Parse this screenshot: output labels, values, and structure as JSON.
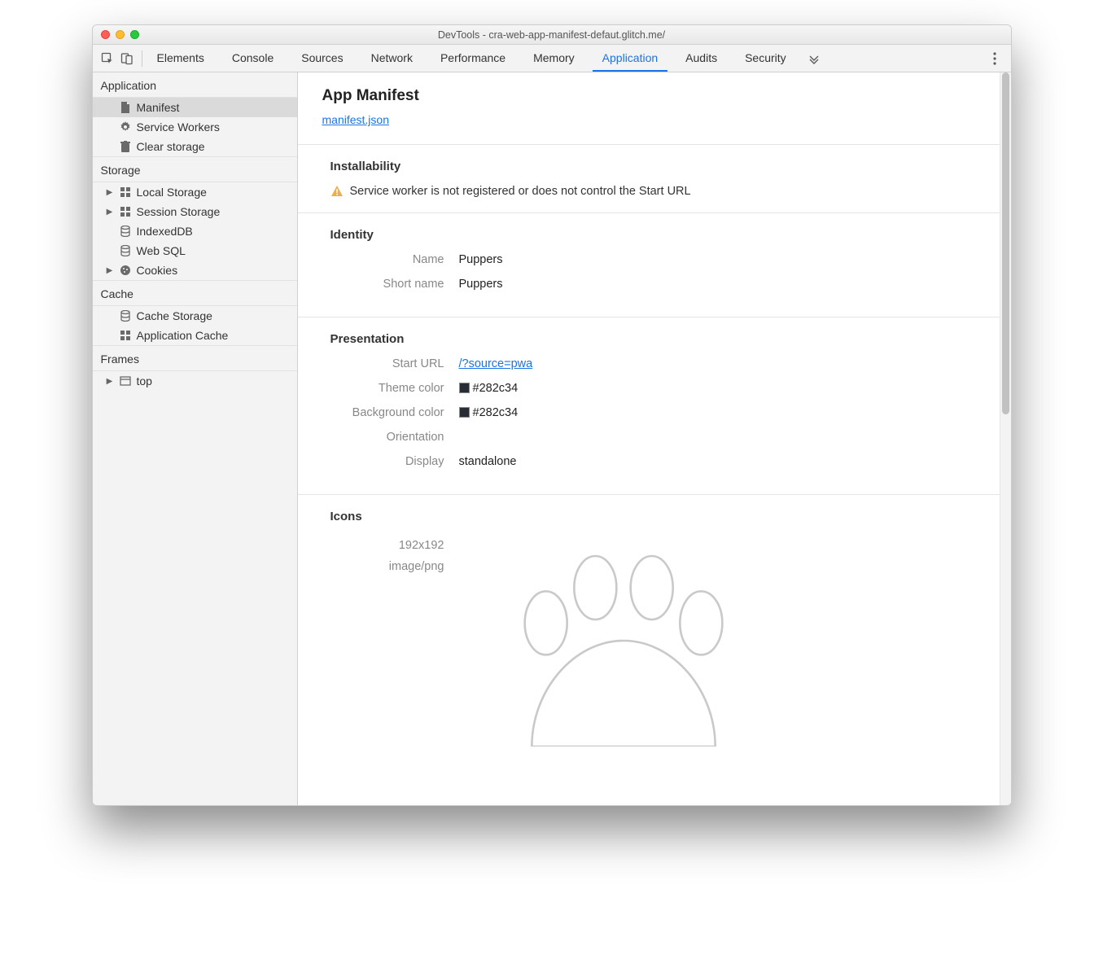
{
  "window": {
    "title": "DevTools - cra-web-app-manifest-defaut.glitch.me/"
  },
  "tabs": [
    {
      "label": "Elements"
    },
    {
      "label": "Console"
    },
    {
      "label": "Sources"
    },
    {
      "label": "Network"
    },
    {
      "label": "Performance"
    },
    {
      "label": "Memory"
    },
    {
      "label": "Application"
    },
    {
      "label": "Audits"
    },
    {
      "label": "Security"
    }
  ],
  "sidebar": {
    "application": {
      "title": "Application",
      "items": [
        {
          "label": "Manifest"
        },
        {
          "label": "Service Workers"
        },
        {
          "label": "Clear storage"
        }
      ]
    },
    "storage": {
      "title": "Storage",
      "items": [
        {
          "label": "Local Storage"
        },
        {
          "label": "Session Storage"
        },
        {
          "label": "IndexedDB"
        },
        {
          "label": "Web SQL"
        },
        {
          "label": "Cookies"
        }
      ]
    },
    "cache": {
      "title": "Cache",
      "items": [
        {
          "label": "Cache Storage"
        },
        {
          "label": "Application Cache"
        }
      ]
    },
    "frames": {
      "title": "Frames",
      "items": [
        {
          "label": "top"
        }
      ]
    }
  },
  "manifest": {
    "heading": "App Manifest",
    "link_text": "manifest.json",
    "installability": {
      "heading": "Installability",
      "warning": "Service worker is not registered or does not control the Start URL"
    },
    "identity": {
      "heading": "Identity",
      "name_label": "Name",
      "name_value": "Puppers",
      "shortname_label": "Short name",
      "shortname_value": "Puppers"
    },
    "presentation": {
      "heading": "Presentation",
      "start_url_label": "Start URL",
      "start_url_value": "/?source=pwa",
      "theme_color_label": "Theme color",
      "theme_color_value": "#282c34",
      "bg_color_label": "Background color",
      "bg_color_value": "#282c34",
      "orientation_label": "Orientation",
      "orientation_value": "",
      "display_label": "Display",
      "display_value": "standalone"
    },
    "icons": {
      "heading": "Icons",
      "size": "192x192",
      "mime": "image/png"
    }
  }
}
